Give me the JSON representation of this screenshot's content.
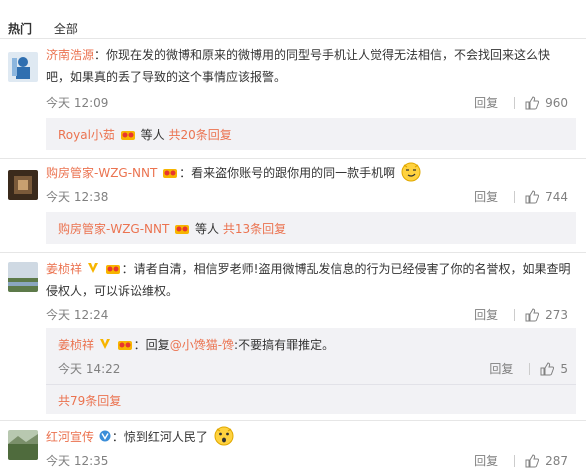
{
  "tabs": {
    "hot": "热门",
    "all": "全部"
  },
  "comments": [
    {
      "user": "济南浩源",
      "text": "：你现在发的微博和原来的微博用的同型号手机让人觉得无法相信，不会找回来这么快",
      "text2": "吧，如果真的丢了导致的这个事情应该报警。",
      "time": "今天 12:09",
      "reply": "回复",
      "likes": "960",
      "sub_summary": {
        "user": "Royal小茹",
        "tail": "等人",
        "count": "共20条回复"
      }
    },
    {
      "user": "购房管家-WZG-NNT",
      "text": "：看来盗你账号的跟你用的同一款手机啊",
      "time": "今天 12:38",
      "reply": "回复",
      "likes": "744",
      "sub_summary": {
        "user": "购房管家-WZG-NNT",
        "tail": "等人",
        "count": "共13条回复"
      }
    },
    {
      "user": "姜桢祥",
      "text": "：请者自清，相信罗老师!盗用微博乱发信息的行为已经侵害了你的名誉权，如果查明",
      "text2": "侵权人，可以诉讼维权。",
      "time": "今天 12:24",
      "reply": "回复",
      "likes": "273",
      "sub_reply": {
        "user": "姜桢祥",
        "prefix": "：回复",
        "mention": "@小馋猫-馋",
        "text": ":不要搞有罪推定。",
        "time": "今天 14:22",
        "reply": "回复",
        "likes": "5"
      },
      "sub_total": "共79条回复"
    },
    {
      "user": "红河宣传",
      "text": "：惊到红河人民了",
      "time": "今天 12:35",
      "reply": "回复",
      "likes": "287"
    }
  ],
  "colors": {
    "username": "#eb7350",
    "meta": "#808080",
    "subbox": "#f2f2f5"
  }
}
